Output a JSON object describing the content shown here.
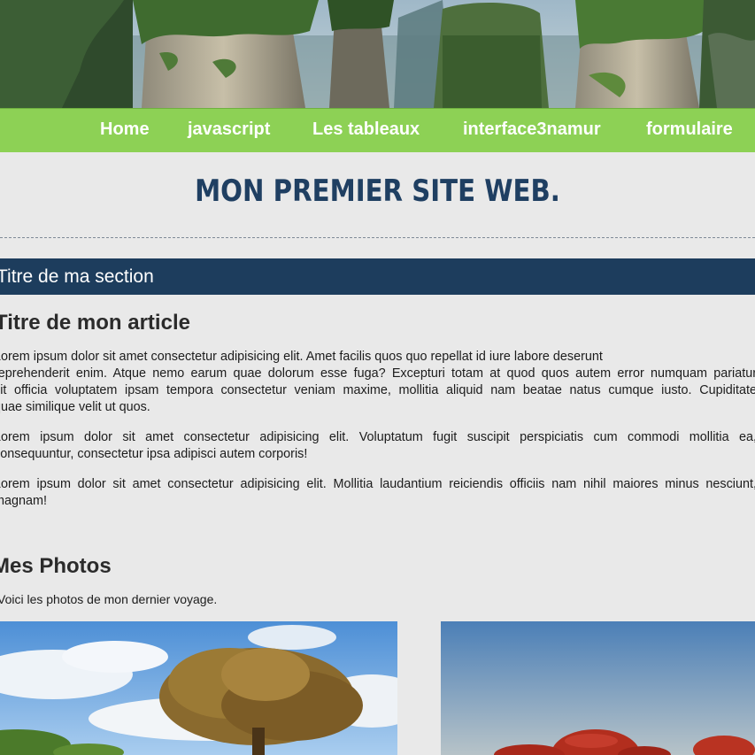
{
  "nav": {
    "items": [
      "Home",
      "javascript",
      "Les tableaux",
      "interface3namur",
      "formulaire"
    ]
  },
  "header": {
    "site_title": "MON PREMIER SITE WEB."
  },
  "section": {
    "title": "Titre de ma section",
    "article_title": "Titre de mon article",
    "paragraphs": [
      [
        "Lorem ipsum dolor sit amet consectetur adipisicing elit. Amet facilis quos quo repellat id iure labore deserunt",
        "reprehenderit enim. Atque nemo earum quae dolorum esse fuga? Excepturi totam at quod quos autem error numquam pariatur",
        "sit officia voluptatem ipsam tempora consectetur veniam maxime, mollitia aliquid nam beatae natus cumque iusto. Cupiditate",
        "quae similique velit ut quos."
      ],
      [
        "Lorem ipsum dolor sit amet consectetur adipisicing elit. Voluptatum fugit suscipit perspiciatis cum commodi mollitia ea,",
        "consequuntur, consectetur ipsa adipisci autem corporis!"
      ],
      [
        "Lorem ipsum dolor sit amet consectetur adipisicing elit. Mollitia laudantium reiciendis officiis nam nihil maiores minus nesciunt,",
        "magnam!"
      ]
    ]
  },
  "photos": {
    "title": "Mes Photos",
    "caption": "Voici les photos de mon dernier voyage.",
    "images": [
      "tree-on-hill-photo",
      "red-rocks-photo"
    ]
  },
  "colors": {
    "nav_bg": "#8dd155",
    "title": "#1f3f62",
    "section_bar": "#1d3d5d",
    "page_bg": "#e9e9e9"
  }
}
